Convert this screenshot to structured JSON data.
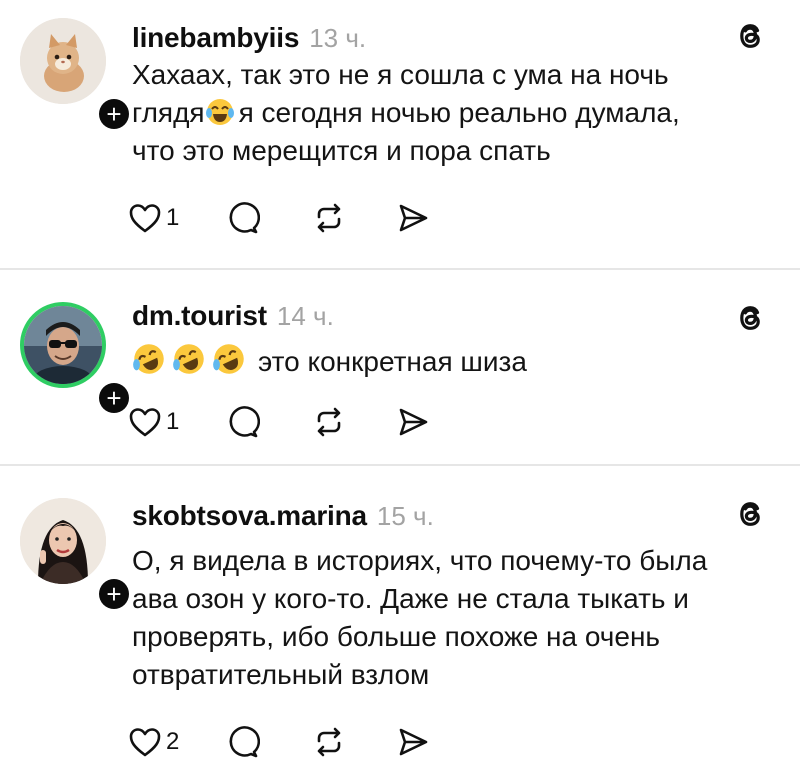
{
  "posts": [
    {
      "username": "linebambyiis",
      "time": "13 ч.",
      "text": "Хахаах, так это не я сошла с ума на ночь глядя😂я сегодня ночью реально думала, что это мерещится и пора спать",
      "line1": "Хахаах, так это не я сошла с ума на ночь",
      "line2a": "глядя",
      "emoji2": "😂",
      "line2b": "я сегодня ночью реально думала,",
      "line3": "что это мерещится и пора спать",
      "likes": "1",
      "follow": "+"
    },
    {
      "username": "dm.tourist",
      "time": "14 ч.",
      "emoji": "🤣🤣🤣",
      "text": "это конкретная шиза",
      "likes": "1",
      "follow": "+"
    },
    {
      "username": "skobtsova.marina",
      "time": "15 ч.",
      "line1": "О, я видела в историях, что почему-то была",
      "line2": "ава озон у кого-то. Даже не стала тыкать и",
      "line3": "проверять, ибо больше похоже на очень",
      "line4": "отвратительный взлом",
      "likes": "2",
      "follow": "+"
    }
  ],
  "icons": {
    "like": "heart-icon",
    "comment": "comment-icon",
    "repost": "repost-icon",
    "share": "share-icon",
    "app": "threads-logo-icon"
  }
}
